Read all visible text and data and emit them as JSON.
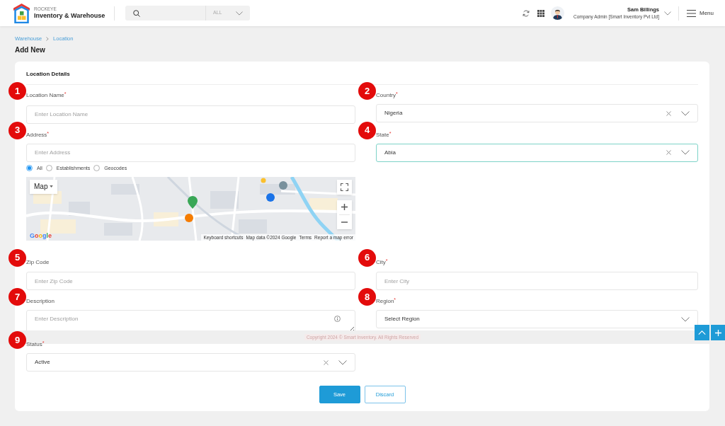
{
  "header": {
    "brand_overline": "ROCKEYE",
    "brand_name": "Inventory & Warehouse",
    "search_scope": "ALL",
    "user": {
      "name": "Sam Billings",
      "role": "Company Admin [Smart Inventory Pvt Ltd]"
    },
    "menu_label": "Menu"
  },
  "breadcrumb": [
    {
      "label": "Warehouse"
    },
    {
      "label": "Location"
    }
  ],
  "page_title": "Add New",
  "form": {
    "title": "Location Details",
    "required_marker": "*",
    "rows": [
      [
        {
          "callout": "1",
          "label": "Location Name",
          "required": true,
          "kind": "text",
          "placeholder": "Enter Location Name"
        },
        {
          "callout": "2",
          "label": "Country",
          "required": true,
          "kind": "select",
          "value": "Nigeria",
          "clearable": true,
          "focused": false
        }
      ],
      [
        {
          "callout": "3",
          "label": "Address",
          "required": true,
          "kind": "address",
          "placeholder": "Enter Address",
          "search_types": [
            {
              "label": "All",
              "selected": true
            },
            {
              "label": "Establishments",
              "selected": false
            },
            {
              "label": "Geocodes",
              "selected": false
            }
          ],
          "map": {
            "type_button": "Map",
            "logo": "Google",
            "attribution": [
              "Keyboard shortcuts",
              "Map data ©2024 Google",
              "Terms",
              "Report a map error"
            ]
          }
        },
        {
          "callout": "4",
          "label": "State",
          "required": true,
          "kind": "select",
          "value": "Abia",
          "clearable": true,
          "focused": true
        }
      ],
      [
        {
          "callout": "5",
          "label": "Zip Code",
          "required": false,
          "kind": "text",
          "placeholder": "Enter Zip Code"
        },
        {
          "callout": "6",
          "label": "City",
          "required": true,
          "kind": "text",
          "placeholder": "Enter City"
        }
      ],
      [
        {
          "callout": "7",
          "label": "Description",
          "required": false,
          "kind": "textarea",
          "placeholder": "Enter Description"
        },
        {
          "callout": "8",
          "label": "Region",
          "required": true,
          "kind": "select",
          "placeholder": "Select Region",
          "clearable": false,
          "focused": false
        }
      ],
      [
        {
          "callout": "9",
          "label": "Status",
          "required": true,
          "kind": "select",
          "value": "Active",
          "clearable": true,
          "focused": false
        }
      ]
    ],
    "actions": [
      {
        "label": "Save",
        "kind": "primary"
      },
      {
        "label": "Discard",
        "kind": "secondary"
      }
    ]
  },
  "footer": {
    "copyright": "Copyright 2024 © Smart Inventory. All Rights Reserved"
  }
}
